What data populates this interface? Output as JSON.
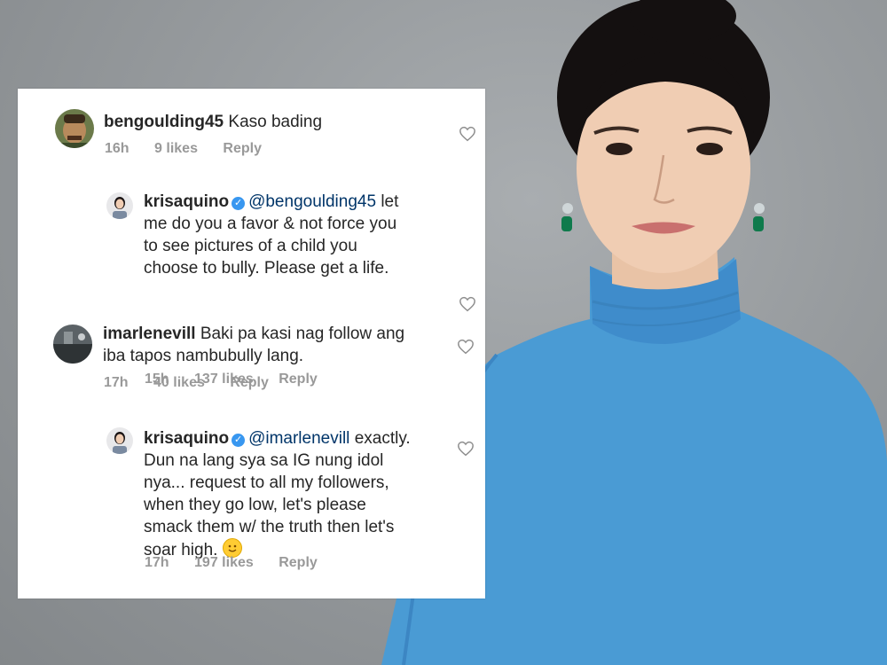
{
  "comments": [
    {
      "username": "bengoulding45",
      "verified": false,
      "text": "Kaso bading",
      "time": "16h",
      "likes": "9 likes",
      "reply": "Reply",
      "avatar_icon": "man-photo-avatar"
    },
    {
      "username": "krisaquino",
      "verified": true,
      "mention": "@bengoulding45",
      "text_line1": "let",
      "text_rest": [
        "me do you a favor & not force you",
        "to see pictures of a child you",
        "choose to bully. Please get a life."
      ],
      "time": "15h",
      "likes": "137 likes",
      "reply": "Reply",
      "avatar_icon": "woman-photo-avatar"
    },
    {
      "username": "imarlenevill",
      "verified": false,
      "text": "Baki pa kasi nag follow ang",
      "text_line2": "iba tapos nambubully lang.",
      "time": "17h",
      "likes": "40 likes",
      "reply": "Reply",
      "avatar_icon": "landscape-photo-avatar"
    },
    {
      "username": "krisaquino",
      "verified": true,
      "mention": "@imarlenevill",
      "text_line1": "exactly.",
      "text_rest": [
        "Dun na lang sya sa IG nung idol",
        "nya... request to all my followers,",
        "when they go low, let's please",
        "smack them w/ the truth then let's"
      ],
      "text_last": "soar high.",
      "emoji": "smiling-face-emoji",
      "time": "17h",
      "likes": "197 likes",
      "reply": "Reply",
      "avatar_icon": "woman-photo-avatar"
    }
  ],
  "colors": {
    "text": "#262626",
    "meta": "#999999",
    "mention": "#003569",
    "verified_badge": "#3897f0",
    "sweater": "#4a9bd4",
    "background": "#979b9e"
  },
  "icons": {
    "like": "heart-outline-icon",
    "verified": "verified-badge-icon"
  }
}
